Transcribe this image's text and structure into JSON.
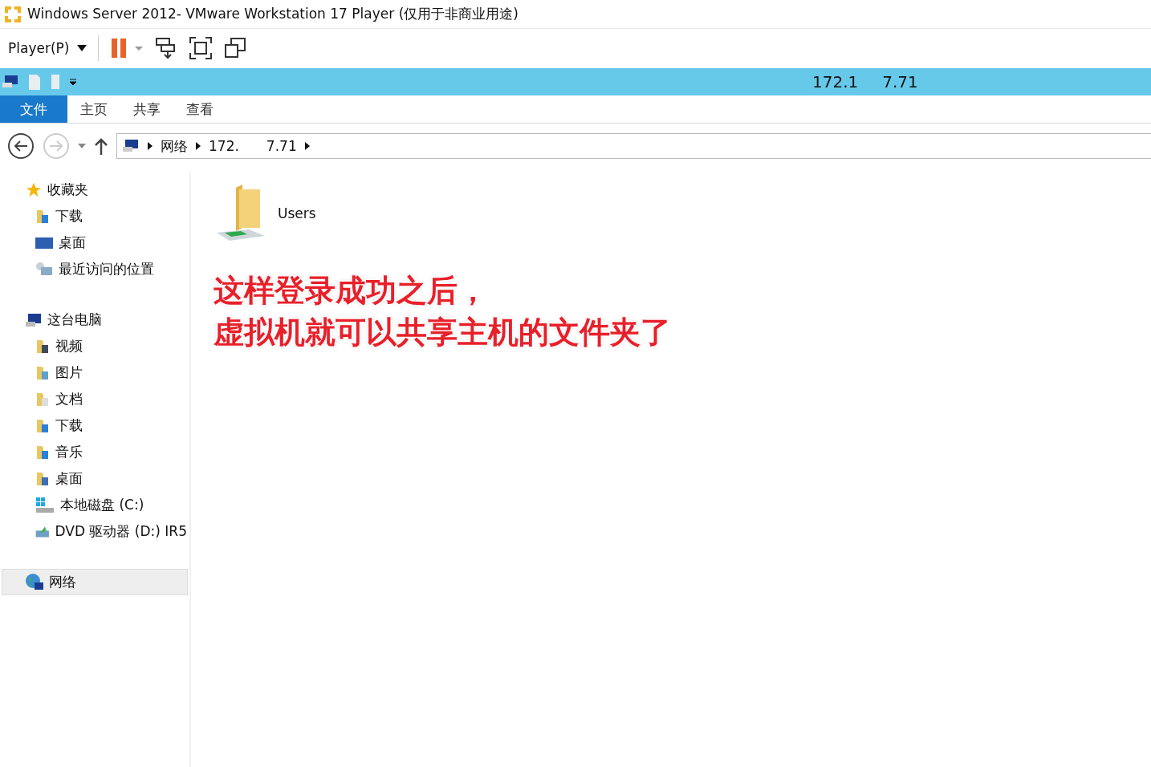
{
  "window": {
    "title": "Windows Server 2012- VMware Workstation 17 Player (仅用于非商业用途)"
  },
  "player_toolbar": {
    "menu": "Player(P)"
  },
  "quick_access": {
    "title_start": "172.1",
    "title_end": "7.71"
  },
  "ribbon": {
    "tabs": [
      {
        "label": "文件",
        "selected": true
      },
      {
        "label": "主页",
        "selected": false
      },
      {
        "label": "共享",
        "selected": false
      },
      {
        "label": "查看",
        "selected": false
      }
    ]
  },
  "address": {
    "segments": [
      {
        "label": "网络"
      },
      {
        "label": "172.",
        "tail": "7.71"
      }
    ]
  },
  "sidebar": {
    "groups": [
      {
        "kind": "favorites",
        "label": "收藏夹",
        "selected": false,
        "children": [
          {
            "kind": "download",
            "label": "下载"
          },
          {
            "kind": "desktop",
            "label": "桌面"
          },
          {
            "kind": "recent",
            "label": "最近访问的位置"
          }
        ]
      },
      {
        "kind": "pc",
        "label": "这台电脑",
        "selected": false,
        "children": [
          {
            "kind": "video",
            "label": "视频"
          },
          {
            "kind": "pictures",
            "label": "图片"
          },
          {
            "kind": "docs",
            "label": "文档"
          },
          {
            "kind": "download",
            "label": "下载"
          },
          {
            "kind": "music",
            "label": "音乐"
          },
          {
            "kind": "desktopfolder",
            "label": "桌面"
          },
          {
            "kind": "disk",
            "label": "本地磁盘 (C:)"
          },
          {
            "kind": "dvd",
            "label": "DVD 驱动器 (D:) IR5"
          }
        ]
      },
      {
        "kind": "network",
        "label": "网络",
        "selected": true
      }
    ]
  },
  "content": {
    "items": [
      {
        "label": "Users"
      }
    ]
  },
  "annotation": [
    "这样登录成功之后，",
    "虚拟机就可以共享主机的文件夹了"
  ]
}
